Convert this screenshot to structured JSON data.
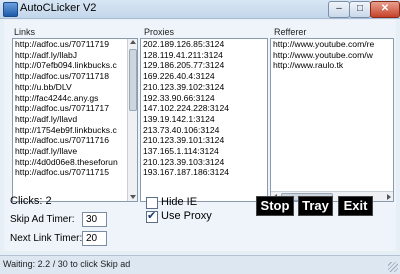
{
  "window": {
    "title": "AutoCLicker V2",
    "minimize_glyph": "–",
    "maximize_glyph": "□",
    "close_glyph": "✕"
  },
  "links": {
    "label": "Links",
    "items": [
      "http://adfoc.us/70711719",
      "http://adf.ly/llabJ",
      "http://07efb094.linkbucks.c",
      "http://adfoc.us/70711718",
      "http://u.bb/DLV",
      "http://fac4244c.any.gs",
      "http://adfoc.us/70711717",
      "http://adf.ly/llavd",
      "http://1754eb9f.linkbucks.c",
      "http://adfoc.us/70711716",
      "http://adf.ly/llave",
      "http://4d0d06e8.theseforun",
      "http://adfoc.us/70711715"
    ]
  },
  "proxies": {
    "label": "Proxies",
    "items": [
      "202.189.126.85:3124",
      "128.119.41.211:3124",
      "129.186.205.77:3124",
      "169.226.40.4:3124",
      "210.123.39.102:3124",
      "192.33.90.66:3124",
      "147.102.224.228:3124",
      "139.19.142.1:3124",
      "213.73.40.106:3124",
      "210.123.39.101:3124",
      "137.165.1.114:3124",
      "210.123.39.103:3124",
      "193.167.187.186:3124"
    ]
  },
  "refferer": {
    "label": "Refferer",
    "items": [
      "http://www.youtube.com/re",
      "http://www.youtube.com/w",
      "http://www.raulo.tk"
    ]
  },
  "clicks": {
    "label": "Clicks: 2"
  },
  "skip_ad_timer": {
    "label": "Skip Ad Timer:",
    "value": "30"
  },
  "next_link_timer": {
    "label": "Next Link Timer:",
    "value": "20"
  },
  "options": {
    "hide_ie": {
      "label": "Hide IE",
      "checked": false
    },
    "use_proxy": {
      "label": "Use Proxy",
      "checked": true,
      "mark": "✔"
    }
  },
  "buttons": {
    "stop": "Stop",
    "tray": "Tray",
    "exit": "Exit"
  },
  "status": {
    "text": "Waiting: 2.2 / 30 to click Skip ad"
  }
}
